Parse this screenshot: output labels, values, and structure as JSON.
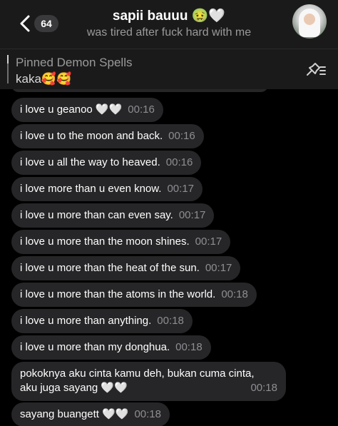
{
  "header": {
    "back_count": "64",
    "title": "sapii bauuu 🤢🤍",
    "subtitle": "was tired after fuck hard with me"
  },
  "pinned": {
    "title": "Pinned Demon Spells",
    "text": "kaka🥰🥰"
  },
  "messages": [
    {
      "text": "i love u geanoo 🤍🤍",
      "time": "00:16"
    },
    {
      "text": "i love u to the moon and back.",
      "time": "00:16"
    },
    {
      "text": "i love u all the way to heaved.",
      "time": "00:16"
    },
    {
      "text": "i love more than u even know.",
      "time": "00:17"
    },
    {
      "text": "i love u more than can even say.",
      "time": "00:17"
    },
    {
      "text": "i love u more than the moon shines.",
      "time": "00:17"
    },
    {
      "text": "i love u more than the heat of the sun.",
      "time": "00:17"
    },
    {
      "text": "i love u more than the atoms in the world.",
      "time": "00:18"
    },
    {
      "text": "i love u more than anything.",
      "time": "00:18"
    },
    {
      "text": "i love u more than my donghua.",
      "time": "00:18"
    },
    {
      "line1": "pokoknya aku cinta kamu deh, bukan cuma cinta,",
      "line2": "aku juga sayang 🤍🤍",
      "time": "00:18"
    },
    {
      "text": "sayang buangett 🤍🤍",
      "time": "00:18"
    }
  ]
}
